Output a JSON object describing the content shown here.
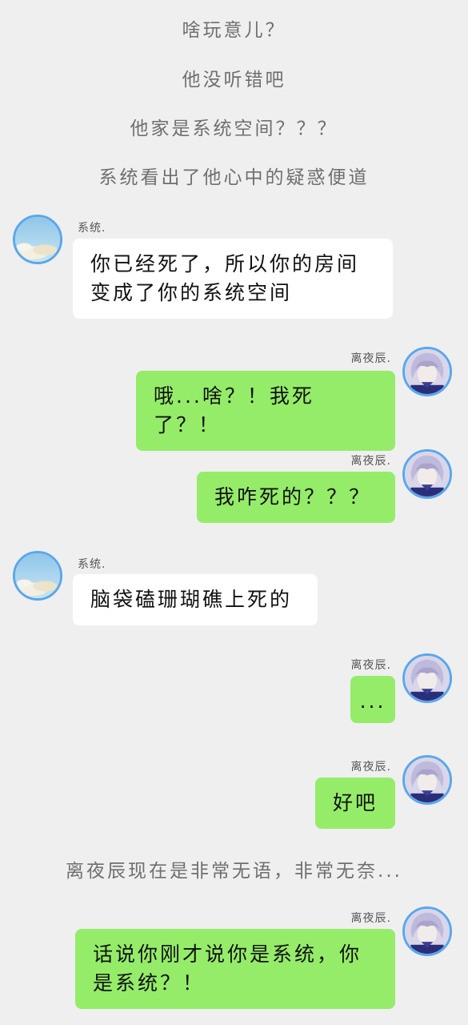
{
  "narration": [
    "啥玩意儿？",
    "他没听错吧",
    "他家是系统空间？？？",
    "系统看出了他心中的疑惑便道",
    "离夜辰现在是非常无语，非常无奈..."
  ],
  "messages": [
    {
      "sender": "系统.",
      "text": "你已经死了，所以你的房间变成了你的系统空间"
    },
    {
      "sender": "离夜辰.",
      "text": "哦...啥？！我死了？！"
    },
    {
      "sender": "离夜辰.",
      "text": "我咋死的？？？"
    },
    {
      "sender": "系统.",
      "text": "脑袋磕珊瑚礁上死的"
    },
    {
      "sender": "离夜辰.",
      "text": "..."
    },
    {
      "sender": "离夜辰.",
      "text": "好吧"
    },
    {
      "sender": "离夜辰.",
      "text": "话说你刚才说你是系统，你是系统？！"
    }
  ],
  "colors": {
    "background": "#efefef",
    "bubble_left": "#ffffff",
    "bubble_right": "#95ec69",
    "avatar_border": "#5aa7ea"
  },
  "icons": {
    "system_avatar": "sky-clouds-avatar",
    "user_avatar": "anime-boy-avatar"
  }
}
